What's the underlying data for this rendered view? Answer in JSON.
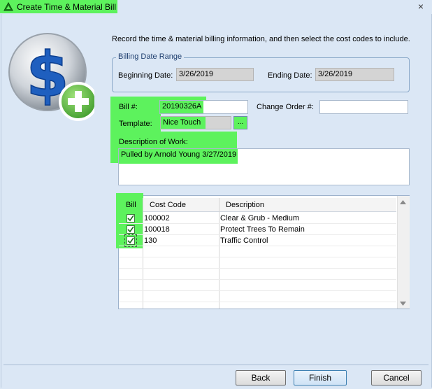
{
  "window": {
    "title": "Create Time & Material Bill",
    "close_glyph": "×",
    "title_icon": "green-triangle-icon"
  },
  "instructions": "Record the time & material billing information, and then select the cost codes to include.",
  "date_range": {
    "group_title": "Billing Date Range",
    "beginning_label": "Beginning Date:",
    "beginning_value": "3/26/2019",
    "ending_label": "Ending Date:",
    "ending_value": "3/26/2019"
  },
  "bill": {
    "bill_no_label": "Bill #:",
    "bill_no_value": "20190326A",
    "change_order_label": "Change Order #:",
    "change_order_value": "",
    "template_label": "Template:",
    "template_value": "Nice Touch",
    "template_browse": "...",
    "description_label": "Description of Work:",
    "description_value": "Pulled by Arnold Young 3/27/2019"
  },
  "grid": {
    "columns": [
      "Bill",
      "Cost Code",
      "Description"
    ],
    "rows": [
      {
        "checked": true,
        "code": "100002",
        "description": "Clear & Grub - Medium"
      },
      {
        "checked": true,
        "code": "100018",
        "description": "Protect Trees To Remain"
      },
      {
        "checked": true,
        "code": "130",
        "description": "Traffic Control"
      }
    ]
  },
  "buttons": {
    "back": "Back",
    "finish": "Finish",
    "cancel": "Cancel"
  },
  "colors": {
    "highlight": "#5df25d",
    "background": "#dbe7f5"
  }
}
